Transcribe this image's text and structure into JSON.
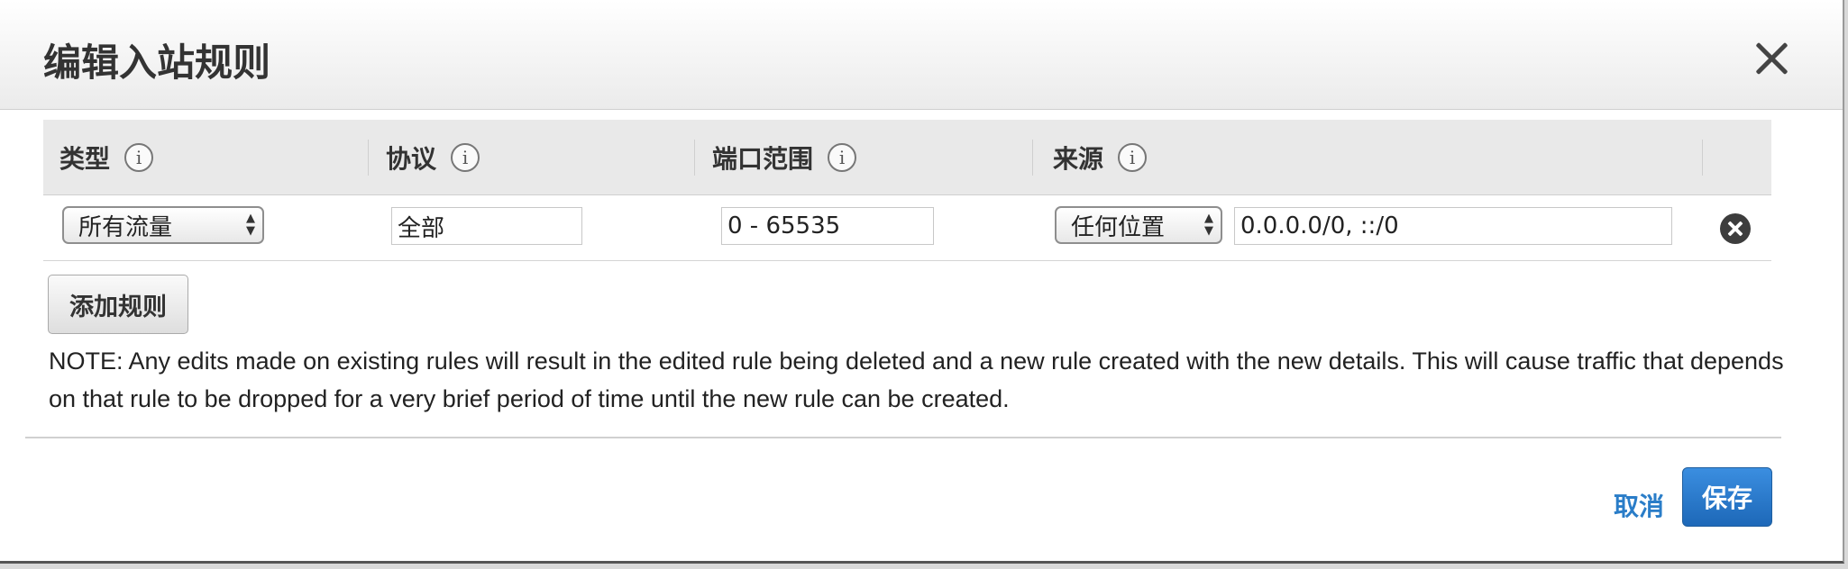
{
  "dialog": {
    "title": "编辑入站规则"
  },
  "table": {
    "headers": {
      "type": "类型",
      "protocol": "协议",
      "port_range": "端口范围",
      "source": "来源"
    },
    "rows": [
      {
        "type": "所有流量",
        "protocol": "全部",
        "port_range": "0 - 65535",
        "source_type": "任何位置",
        "source_value": "0.0.0.0/0, ::/0"
      }
    ]
  },
  "actions": {
    "add_rule": "添加规则",
    "cancel": "取消",
    "save": "保存"
  },
  "note": "NOTE: Any edits made on existing rules will result in the edited rule being deleted and a new rule created with the new details. This will cause traffic that depends on that rule to be dropped for a very brief period of time until the new rule can be created.",
  "icons": {
    "info": "i",
    "select_arrows_up": "▲",
    "select_arrows_down": "▼"
  },
  "colors": {
    "primary_button": "#1d68b8",
    "link": "#2a7dc8"
  }
}
